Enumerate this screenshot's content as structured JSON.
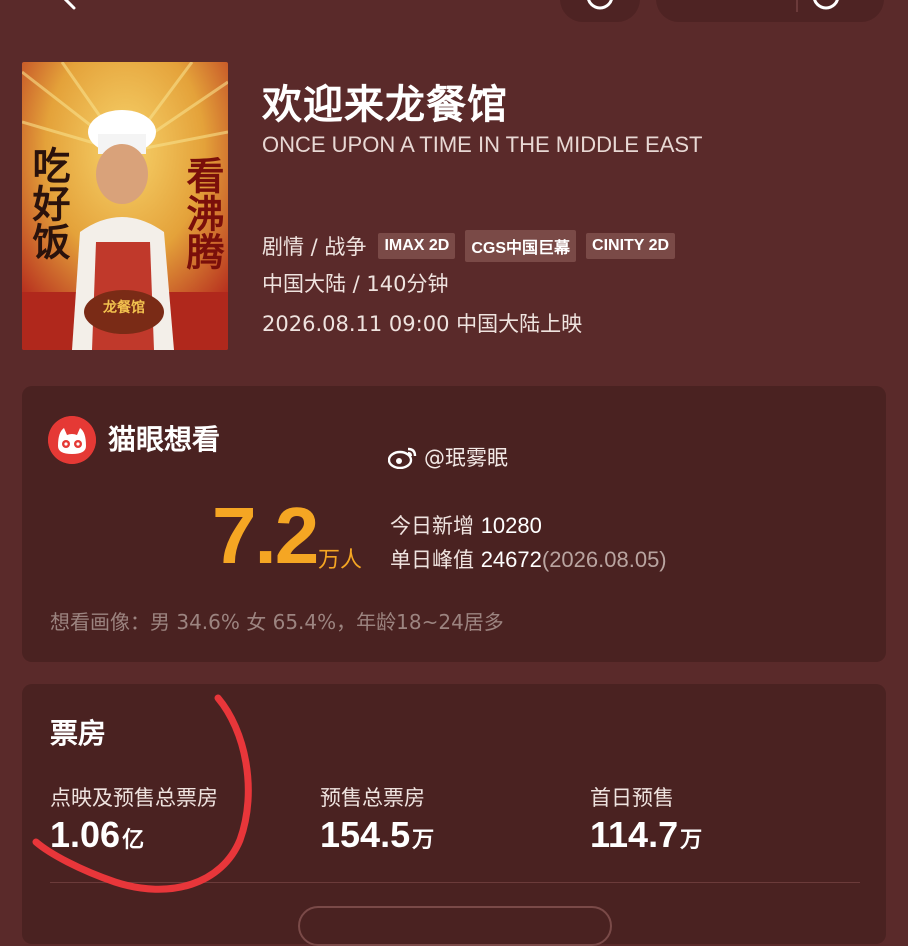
{
  "movie": {
    "title": "欢迎来龙餐馆",
    "english_title": "ONCE UPON A TIME IN THE MIDDLE EAST",
    "genres": "剧情 / 战争",
    "formats": [
      "IMAX 2D",
      "CGS中国巨幕",
      "CINITY 2D"
    ],
    "region_runtime": "中国大陆 / 140分钟",
    "release": "2026.08.11 09:00 中国大陆上映",
    "poster": {
      "left_text": "吃好饭",
      "right_text": "看沸腾",
      "bg_color": "#c0392b",
      "accent_color": "#f2c14e"
    }
  },
  "want": {
    "logo_icon": "maoyan-cat-icon",
    "heading": "猫眼想看",
    "weibo_icon": "weibo-icon",
    "watermark": "@珉雾眠",
    "count": "7.2",
    "count_unit": "万人",
    "today_label": "今日新增",
    "today_value": "10280",
    "peak_label": "单日峰值",
    "peak_value": "24672",
    "peak_date": "(2026.08.05)",
    "portrait": "想看画像：男 34.6% 女 65.4%，年龄18~24居多"
  },
  "boxoffice": {
    "heading": "票房",
    "items": [
      {
        "label": "点映及预售总票房",
        "value": "1.06",
        "unit": "亿"
      },
      {
        "label": "预售总票房",
        "value": "154.5",
        "unit": "万"
      },
      {
        "label": "首日预售",
        "value": "114.7",
        "unit": "万"
      }
    ]
  },
  "colors": {
    "background": "#5a2a2a",
    "card": "#4a2221",
    "accent": "#f5a623",
    "tag": "#7a4a47",
    "annotation": "#e8363a"
  }
}
